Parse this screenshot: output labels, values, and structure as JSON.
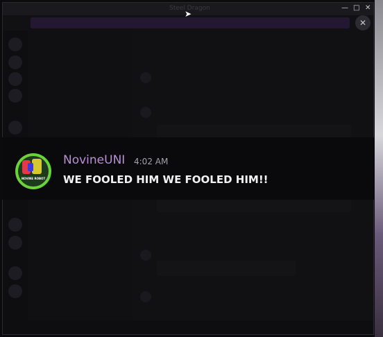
{
  "window": {
    "title": "Steel Dragon"
  },
  "overlay_message": {
    "username": "NovineUNI",
    "timestamp": "4:02 AM",
    "text": "WE FOOLED HIM WE FOOLED HIM!!",
    "avatar_caption": "NOVINE ROBOT"
  },
  "colors": {
    "username": "#b98fd6",
    "timestamp": "#a3a3a8",
    "message": "#f2f2f4",
    "avatar_ring": "#6ad33a",
    "backdrop": "#0a0a0c"
  }
}
